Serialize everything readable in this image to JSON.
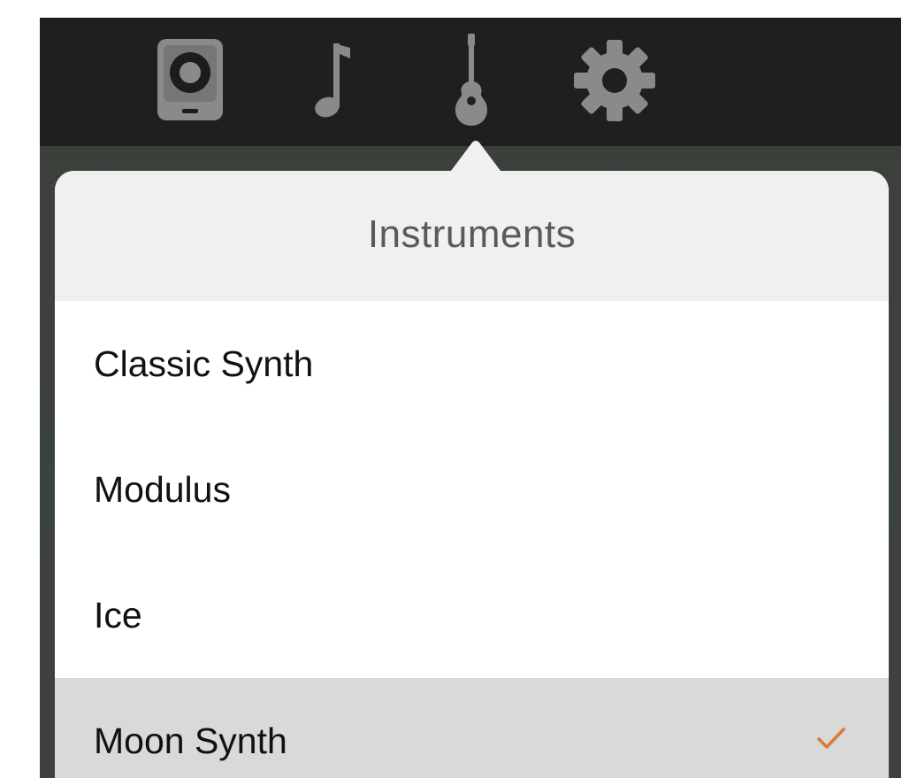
{
  "toolbar": {
    "tools": [
      {
        "name": "speaker",
        "icon": "speaker-icon",
        "selected": false
      },
      {
        "name": "music",
        "icon": "music-note-icon",
        "selected": false
      },
      {
        "name": "instruments",
        "icon": "guitar-icon",
        "selected": true
      },
      {
        "name": "settings",
        "icon": "gear-icon",
        "selected": false
      }
    ]
  },
  "popover": {
    "title": "Instruments",
    "items": [
      {
        "label": "Classic Synth",
        "selected": false
      },
      {
        "label": "Modulus",
        "selected": false
      },
      {
        "label": "Ice",
        "selected": false
      },
      {
        "label": "Moon Synth",
        "selected": true,
        "check_icon": "checkmark-icon"
      }
    ]
  },
  "colors": {
    "toolbar_background": "#1e201e",
    "icon_gray": "#8a8a8a",
    "header_background": "#f0f0f0",
    "selected_row": "#d9d9d9",
    "check_accent": "#d97a3a"
  }
}
